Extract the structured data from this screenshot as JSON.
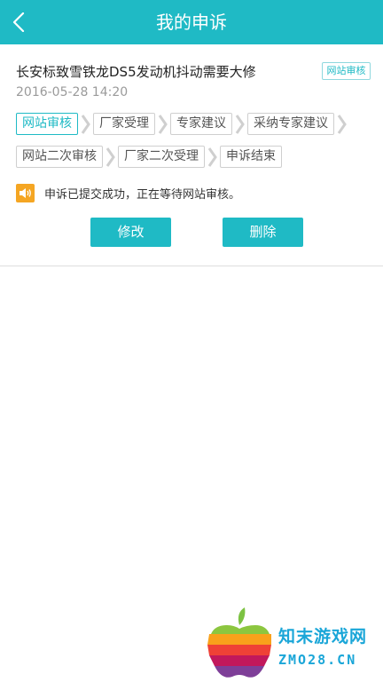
{
  "header": {
    "title": "我的申诉"
  },
  "complaint": {
    "title": "长安标致雪铁龙DS5发动机抖动需要大修",
    "date": "2016-05-28 14:20",
    "status_badge": "网站审核"
  },
  "steps": {
    "row1": [
      "网站审核",
      "厂家受理",
      "专家建议",
      "采纳专家建议"
    ],
    "row2": [
      "网站二次审核",
      "厂家二次受理",
      "申诉结束"
    ],
    "active_index": 0
  },
  "notice": {
    "text": "申诉已提交成功，正在等待网站审核。"
  },
  "actions": {
    "edit_label": "修改",
    "delete_label": "删除"
  },
  "watermark": {
    "name": "知末游戏网",
    "url": "ZMO28.CN"
  },
  "colors": {
    "accent": "#1fbac5",
    "notice_icon": "#f5a623",
    "watermark": "#1aa6d8"
  }
}
